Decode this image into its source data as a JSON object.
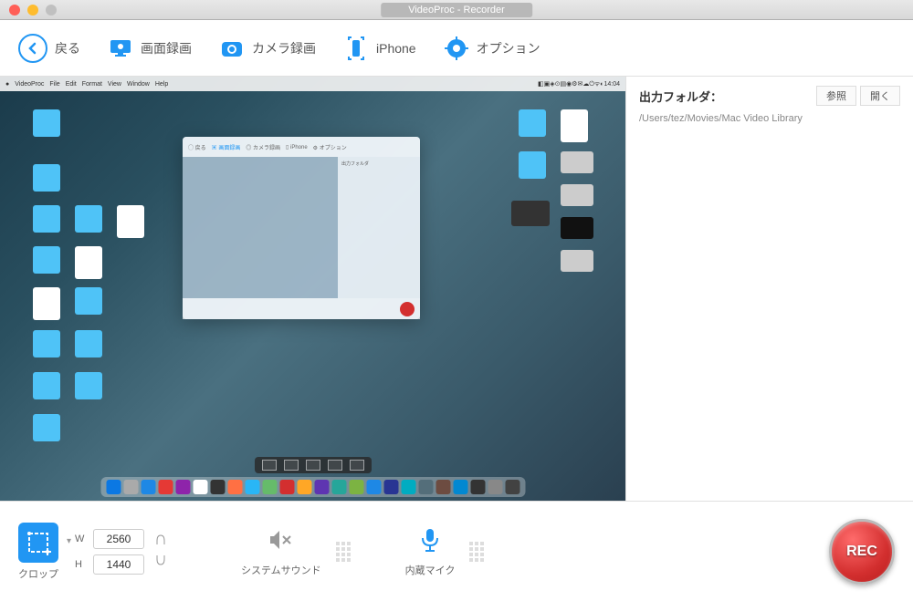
{
  "window": {
    "title": "VideoProc - Recorder"
  },
  "toolbar": {
    "back_label": "戻る",
    "screen_label": "画面録画",
    "camera_label": "カメラ録画",
    "iphone_label": "iPhone",
    "options_label": "オプション"
  },
  "sidebar": {
    "title": "出力フォルダ：",
    "browse_label": "参照",
    "open_label": "開く",
    "path": "/Users/tez/Movies/Mac Video Library"
  },
  "bottombar": {
    "crop_label": "クロップ",
    "width_label": "W",
    "height_label": "H",
    "width_value": "2560",
    "height_value": "1440",
    "system_sound_label": "システムサウンド",
    "mic_label": "内蔵マイク",
    "rec_label": "REC"
  },
  "colors": {
    "accent": "#2196f3",
    "rec": "#d32f2f"
  }
}
